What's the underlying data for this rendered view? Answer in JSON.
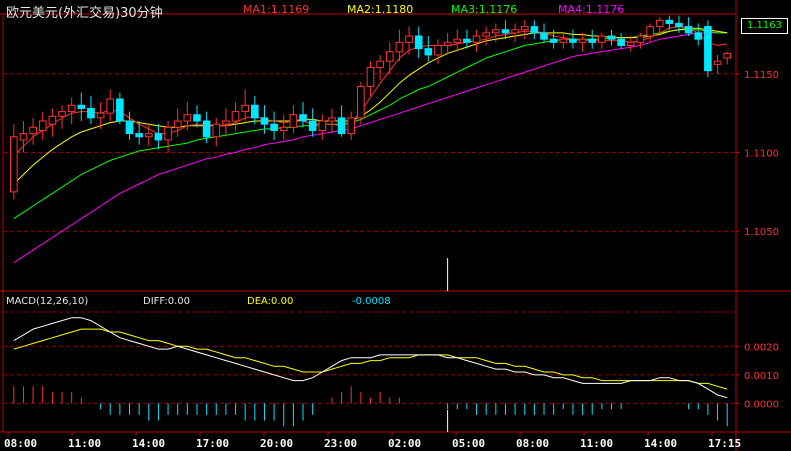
{
  "header": {
    "symbol": "欧元美元(外汇交易)30分钟",
    "ma1": "MA1:1.1169",
    "ma2": "MA2:1.1180",
    "ma3": "MA3:1.1176",
    "ma4": "MA4:1.1176"
  },
  "macd_header": {
    "name": "MACD(12,26,10)",
    "diff": "DIFF:0.00",
    "dea": "DEA:0.00",
    "macd": "-0.0008"
  },
  "price_box": "1.1163",
  "colors": {
    "ma1": "#ff3030",
    "ma2": "#ffff00",
    "ma3": "#00ff00",
    "ma4": "#ff00ff",
    "up": "#ff3030",
    "down": "#00e5ff",
    "grid": "#a00000",
    "axis_text": "#ff3030",
    "diff": "#ffffff",
    "dea": "#ffff00"
  },
  "chart_data": [
    {
      "type": "candlestick",
      "title": "欧元美元(外汇交易)30分钟",
      "y_ticks": [
        "1.1150",
        "1.1100",
        "1.1050"
      ],
      "y_tick_values": [
        1.115,
        1.11,
        1.105
      ],
      "ylim": [
        1.1012,
        1.1188
      ],
      "grid": true,
      "x_ticks": [
        "08:00",
        "11:00",
        "14:00",
        "17:00",
        "20:00",
        "23:00",
        "02:00",
        "05:00",
        "08:00",
        "11:00",
        "14:00",
        "17:15"
      ],
      "candles": [
        [
          1.1075,
          1.1118,
          1.107,
          1.111
        ],
        [
          1.1108,
          1.112,
          1.11,
          1.1112
        ],
        [
          1.1112,
          1.1122,
          1.1105,
          1.1116
        ],
        [
          1.1114,
          1.1126,
          1.1108,
          1.112
        ],
        [
          1.1118,
          1.1128,
          1.111,
          1.1123
        ],
        [
          1.1123,
          1.113,
          1.1115,
          1.1126
        ],
        [
          1.1126,
          1.1135,
          1.1118,
          1.113
        ],
        [
          1.113,
          1.1138,
          1.112,
          1.1128
        ],
        [
          1.1128,
          1.1136,
          1.1118,
          1.1122
        ],
        [
          1.1122,
          1.1132,
          1.1115,
          1.1125
        ],
        [
          1.1125,
          1.114,
          1.112,
          1.1134
        ],
        [
          1.1134,
          1.1138,
          1.1118,
          1.112
        ],
        [
          1.112,
          1.1126,
          1.1108,
          1.1112
        ],
        [
          1.1112,
          1.112,
          1.1105,
          1.111
        ],
        [
          1.111,
          1.1118,
          1.1104,
          1.1112
        ],
        [
          1.1112,
          1.1118,
          1.1102,
          1.1108
        ],
        [
          1.1108,
          1.112,
          1.11,
          1.1116
        ],
        [
          1.1116,
          1.1128,
          1.111,
          1.112
        ],
        [
          1.112,
          1.1132,
          1.1114,
          1.1124
        ],
        [
          1.1124,
          1.113,
          1.1116,
          1.112
        ],
        [
          1.112,
          1.1126,
          1.1106,
          1.111
        ],
        [
          1.111,
          1.1122,
          1.1104,
          1.1118
        ],
        [
          1.1118,
          1.1128,
          1.111,
          1.112
        ],
        [
          1.112,
          1.1132,
          1.1114,
          1.1126
        ],
        [
          1.1126,
          1.114,
          1.112,
          1.113
        ],
        [
          1.113,
          1.1136,
          1.1118,
          1.1122
        ],
        [
          1.1122,
          1.113,
          1.1112,
          1.1118
        ],
        [
          1.1118,
          1.1126,
          1.1108,
          1.1114
        ],
        [
          1.1114,
          1.1124,
          1.1108,
          1.1116
        ],
        [
          1.1116,
          1.113,
          1.1112,
          1.1124
        ],
        [
          1.1124,
          1.1132,
          1.1116,
          1.112
        ],
        [
          1.112,
          1.1128,
          1.111,
          1.1114
        ],
        [
          1.1114,
          1.1124,
          1.1108,
          1.112
        ],
        [
          1.112,
          1.1128,
          1.1112,
          1.1122
        ],
        [
          1.1122,
          1.113,
          1.111,
          1.1112
        ],
        [
          1.1112,
          1.1126,
          1.1108,
          1.1122
        ],
        [
          1.1122,
          1.1145,
          1.1118,
          1.1142
        ],
        [
          1.1142,
          1.1158,
          1.1136,
          1.1154
        ],
        [
          1.1154,
          1.1162,
          1.1146,
          1.1158
        ],
        [
          1.1158,
          1.117,
          1.115,
          1.1164
        ],
        [
          1.1164,
          1.1178,
          1.1158,
          1.117
        ],
        [
          1.117,
          1.118,
          1.1162,
          1.1174
        ],
        [
          1.1174,
          1.118,
          1.116,
          1.1166
        ],
        [
          1.1166,
          1.1174,
          1.1158,
          1.1162
        ],
        [
          1.1162,
          1.1172,
          1.1156,
          1.1168
        ],
        [
          1.1168,
          1.1176,
          1.1162,
          1.117
        ],
        [
          1.117,
          1.1178,
          1.1164,
          1.1172
        ],
        [
          1.1172,
          1.1178,
          1.1166,
          1.117
        ],
        [
          1.117,
          1.1178,
          1.1164,
          1.1174
        ],
        [
          1.1174,
          1.118,
          1.1168,
          1.1176
        ],
        [
          1.1176,
          1.1182,
          1.117,
          1.1178
        ],
        [
          1.1178,
          1.1184,
          1.1172,
          1.1176
        ],
        [
          1.1176,
          1.1182,
          1.117,
          1.1178
        ],
        [
          1.1178,
          1.1184,
          1.1172,
          1.118
        ],
        [
          1.118,
          1.1184,
          1.1172,
          1.1176
        ],
        [
          1.1176,
          1.1182,
          1.117,
          1.1172
        ],
        [
          1.1172,
          1.1178,
          1.1166,
          1.117
        ],
        [
          1.117,
          1.1176,
          1.1166,
          1.1172
        ],
        [
          1.1172,
          1.1178,
          1.1166,
          1.117
        ],
        [
          1.117,
          1.1176,
          1.1164,
          1.1172
        ],
        [
          1.1172,
          1.1178,
          1.1166,
          1.117
        ],
        [
          1.117,
          1.1176,
          1.1166,
          1.1174
        ],
        [
          1.1174,
          1.1178,
          1.1168,
          1.1172
        ],
        [
          1.1172,
          1.1176,
          1.1166,
          1.1168
        ],
        [
          1.1168,
          1.1174,
          1.1164,
          1.117
        ],
        [
          1.117,
          1.1176,
          1.1166,
          1.1174
        ],
        [
          1.1174,
          1.1182,
          1.117,
          1.118
        ],
        [
          1.118,
          1.1186,
          1.1176,
          1.1184
        ],
        [
          1.1184,
          1.1187,
          1.1178,
          1.1182
        ],
        [
          1.1182,
          1.1187,
          1.1176,
          1.118
        ],
        [
          1.118,
          1.1186,
          1.1174,
          1.1176
        ],
        [
          1.1176,
          1.1182,
          1.1168,
          1.1172
        ],
        [
          1.118,
          1.1184,
          1.1148,
          1.1152
        ],
        [
          1.1156,
          1.1162,
          1.115,
          1.1158
        ],
        [
          1.116,
          1.1164,
          1.1156,
          1.1163
        ]
      ],
      "ma1": [
        1.1098,
        1.1104,
        1.111,
        1.1114,
        1.1118,
        1.1122,
        1.1125,
        1.1126,
        1.1126,
        1.1125,
        1.1127,
        1.1126,
        1.1122,
        1.1118,
        1.1115,
        1.1112,
        1.1112,
        1.1114,
        1.1117,
        1.1118,
        1.1118,
        1.1117,
        1.1117,
        1.1119,
        1.1122,
        1.1123,
        1.1121,
        1.112,
        1.1119,
        1.112,
        1.112,
        1.1118,
        1.1118,
        1.1118,
        1.1117,
        1.1119,
        1.1126,
        1.1135,
        1.1144,
        1.1152,
        1.116,
        1.1165,
        1.1167,
        1.1168,
        1.1168,
        1.1168,
        1.1169,
        1.117,
        1.1171,
        1.1172,
        1.1174,
        1.1175,
        1.1176,
        1.1177,
        1.1177,
        1.1176,
        1.1174,
        1.1173,
        1.1172,
        1.1171,
        1.1171,
        1.1171,
        1.1171,
        1.1171,
        1.117,
        1.1171,
        1.1173,
        1.1176,
        1.1179,
        1.118,
        1.1179,
        1.1176,
        1.117,
        1.1168,
        1.1169
      ],
      "ma2": [
        1.108,
        1.1086,
        1.1092,
        1.1097,
        1.1102,
        1.1106,
        1.111,
        1.1113,
        1.1115,
        1.1117,
        1.1119,
        1.112,
        1.112,
        1.1119,
        1.1118,
        1.1117,
        1.1116,
        1.1116,
        1.1117,
        1.1117,
        1.1117,
        1.1117,
        1.1117,
        1.1118,
        1.1119,
        1.112,
        1.112,
        1.112,
        1.112,
        1.112,
        1.1121,
        1.1121,
        1.112,
        1.112,
        1.112,
        1.112,
        1.1123,
        1.1127,
        1.1132,
        1.1138,
        1.1144,
        1.1149,
        1.1153,
        1.1157,
        1.116,
        1.1163,
        1.1165,
        1.1167,
        1.1169,
        1.1171,
        1.1172,
        1.1173,
        1.1174,
        1.1175,
        1.1176,
        1.1176,
        1.1176,
        1.1176,
        1.1175,
        1.1175,
        1.1174,
        1.1174,
        1.1173,
        1.1173,
        1.1173,
        1.1173,
        1.1174,
        1.1175,
        1.1177,
        1.1178,
        1.1179,
        1.1179,
        1.1178,
        1.1177,
        1.1176
      ],
      "ma3": [
        1.1058,
        1.1062,
        1.1066,
        1.107,
        1.1074,
        1.1078,
        1.1082,
        1.1086,
        1.1089,
        1.1092,
        1.1095,
        1.1097,
        1.1099,
        1.1101,
        1.1102,
        1.1103,
        1.1104,
        1.1105,
        1.1106,
        1.1108,
        1.1109,
        1.111,
        1.1111,
        1.1112,
        1.1113,
        1.1114,
        1.1115,
        1.1115,
        1.1116,
        1.1116,
        1.1117,
        1.1117,
        1.1118,
        1.1118,
        1.1118,
        1.1119,
        1.1121,
        1.1124,
        1.1127,
        1.113,
        1.1134,
        1.1137,
        1.114,
        1.1142,
        1.1145,
        1.1148,
        1.1151,
        1.1154,
        1.1157,
        1.116,
        1.1162,
        1.1164,
        1.1166,
        1.1168,
        1.1169,
        1.117,
        1.1171,
        1.1172,
        1.1172,
        1.1172,
        1.1172,
        1.1172,
        1.1173,
        1.1173,
        1.1173,
        1.1174,
        1.1175,
        1.1176,
        1.1177,
        1.1178,
        1.1178,
        1.1178,
        1.1177,
        1.1176,
        1.1176
      ],
      "ma4": [
        1.103,
        1.1034,
        1.1038,
        1.1042,
        1.1046,
        1.105,
        1.1054,
        1.1058,
        1.1062,
        1.1066,
        1.107,
        1.1074,
        1.1077,
        1.108,
        1.1083,
        1.1086,
        1.1088,
        1.109,
        1.1092,
        1.1094,
        1.1096,
        1.1097,
        1.1099,
        1.11,
        1.1102,
        1.1103,
        1.1105,
        1.1106,
        1.1107,
        1.1108,
        1.111,
        1.1111,
        1.1112,
        1.1113,
        1.1114,
        1.1115,
        1.1117,
        1.1119,
        1.1121,
        1.1123,
        1.1125,
        1.1127,
        1.1129,
        1.1131,
        1.1133,
        1.1135,
        1.1137,
        1.1139,
        1.1141,
        1.1143,
        1.1145,
        1.1147,
        1.1149,
        1.1151,
        1.1153,
        1.1155,
        1.1157,
        1.1159,
        1.1161,
        1.1162,
        1.1163,
        1.1164,
        1.1165,
        1.1166,
        1.1167,
        1.1168,
        1.117,
        1.1172,
        1.1173,
        1.1174,
        1.1175,
        1.1176,
        1.1176,
        1.1176,
        1.1176
      ],
      "volume_markers": [
        45
      ]
    },
    {
      "type": "macd",
      "name": "MACD(12,26,10)",
      "y_ticks": [
        "0.0020",
        "0.0010",
        "0.0000"
      ],
      "y_tick_values": [
        0.002,
        0.001,
        0.0
      ],
      "ylim": [
        -0.001,
        0.0032
      ],
      "grid": true,
      "diff": [
        0.0022,
        0.0024,
        0.0026,
        0.0027,
        0.0028,
        0.0029,
        0.003,
        0.003,
        0.0029,
        0.0027,
        0.0025,
        0.0023,
        0.0022,
        0.0021,
        0.002,
        0.0019,
        0.0019,
        0.002,
        0.0019,
        0.0018,
        0.0017,
        0.0016,
        0.0015,
        0.0014,
        0.0013,
        0.0012,
        0.0011,
        0.001,
        0.0009,
        0.0008,
        0.0008,
        0.0009,
        0.0011,
        0.0013,
        0.0015,
        0.0016,
        0.0016,
        0.0016,
        0.0017,
        0.0017,
        0.0017,
        0.0017,
        0.0017,
        0.0017,
        0.0017,
        0.0016,
        0.0016,
        0.0015,
        0.0014,
        0.0013,
        0.0012,
        0.0012,
        0.0011,
        0.0011,
        0.001,
        0.001,
        0.0009,
        0.0009,
        0.0008,
        0.0007,
        0.0007,
        0.0007,
        0.0007,
        0.0007,
        0.0008,
        0.0008,
        0.0008,
        0.0009,
        0.0009,
        0.0008,
        0.0008,
        0.0007,
        0.0005,
        0.0003,
        0.0002
      ],
      "dea": [
        0.0019,
        0.002,
        0.0021,
        0.0022,
        0.0023,
        0.0024,
        0.0025,
        0.0026,
        0.0026,
        0.0026,
        0.0025,
        0.0025,
        0.0024,
        0.0023,
        0.0022,
        0.0022,
        0.0021,
        0.002,
        0.002,
        0.0019,
        0.0019,
        0.0018,
        0.0017,
        0.0016,
        0.0016,
        0.0015,
        0.0014,
        0.0013,
        0.0013,
        0.0012,
        0.0011,
        0.0011,
        0.0011,
        0.0012,
        0.0013,
        0.0014,
        0.0014,
        0.0015,
        0.0015,
        0.0016,
        0.0016,
        0.0016,
        0.0017,
        0.0017,
        0.0017,
        0.0017,
        0.0016,
        0.0016,
        0.0016,
        0.0015,
        0.0014,
        0.0014,
        0.0013,
        0.0013,
        0.0012,
        0.0011,
        0.0011,
        0.001,
        0.001,
        0.0009,
        0.0009,
        0.0008,
        0.0008,
        0.0008,
        0.0008,
        0.0008,
        0.0008,
        0.0008,
        0.0008,
        0.0008,
        0.0008,
        0.0007,
        0.0007,
        0.0006,
        0.0005
      ],
      "hist": [
        0.0006,
        0.0006,
        0.0006,
        0.0006,
        0.0004,
        0.0004,
        0.0004,
        0.0002,
        0,
        -0.0002,
        -0.0004,
        -0.0004,
        -0.0004,
        -0.0004,
        -0.0006,
        -0.0006,
        -0.0004,
        -0.0004,
        -0.0004,
        -0.0004,
        -0.0004,
        -0.0004,
        -0.0004,
        -0.0004,
        -0.0006,
        -0.0006,
        -0.0006,
        -0.0006,
        -0.0008,
        -0.0008,
        -0.0006,
        -0.0004,
        0,
        0.0002,
        0.0004,
        0.0006,
        0.0004,
        0.0002,
        0.0004,
        0.0002,
        0.0002,
        0,
        0,
        0,
        0,
        -0.0002,
        -0.0002,
        -0.0002,
        -0.0004,
        -0.0004,
        -0.0004,
        -0.0004,
        -0.0004,
        -0.0004,
        -0.0004,
        -0.0004,
        -0.0004,
        -0.0002,
        -0.0004,
        -0.0004,
        -0.0004,
        -0.0002,
        -0.0002,
        -0.0002,
        0,
        0,
        0,
        0,
        0,
        0,
        -0.0002,
        -0.0002,
        -0.0004,
        -0.0006,
        -0.0008
      ],
      "volume_markers": [
        45
      ]
    }
  ]
}
